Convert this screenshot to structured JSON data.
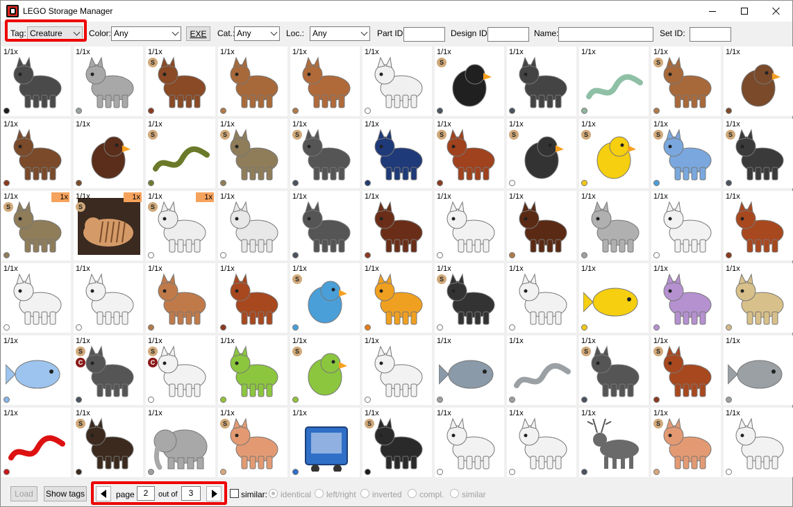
{
  "window": {
    "title": "LEGO Storage Manager"
  },
  "toolbar": {
    "tag_label": "Tag:",
    "tag_value": "Creature",
    "color_label": "Color:",
    "color_value": "Any",
    "exe_label": "EXE",
    "cat_label": "Cat.:",
    "cat_value": "Any",
    "loc_label": "Loc.:",
    "loc_value": "Any",
    "partid_label": "Part ID:",
    "partid_value": "",
    "designid_label": "Design ID:",
    "designid_value": "",
    "name_label": "Name:",
    "name_value": "",
    "setid_label": "Set ID:",
    "setid_value": ""
  },
  "bottom": {
    "load_label": "Load",
    "show_tags_label": "Show tags",
    "page_label": "page",
    "page_value": "2",
    "out_of_label": "out of",
    "total_pages": "3",
    "similar_label": "similar:",
    "options": [
      "identical",
      "left/right",
      "inverted",
      "compl.",
      "similar"
    ]
  },
  "colors": {
    "highlight": "#ee0000",
    "swatches": {
      "black": "#1b1b1b",
      "dkgray": "#4b5260",
      "ltgray": "#9ba0a3",
      "white": "#ffffff",
      "brown": "#7a4a2a",
      "redbrown": "#8a3a1f",
      "mdnougat": "#b07a4a",
      "tan": "#d2b98a",
      "dktan": "#8f7d5a",
      "sandgreen": "#8fb59c",
      "olive": "#707a30",
      "dkblue": "#233a6e",
      "blue": "#2f6fc7",
      "azure": "#4a9fd8",
      "ltblue": "#87b6e8",
      "yellow": "#f3c716",
      "orange": "#e57d1a",
      "lime": "#95c13a",
      "red": "#c81818",
      "lavender": "#b591d0",
      "nougat": "#d9a77a",
      "ltnougat": "#f0c8a0",
      "dkbrown": "#3b2a1d",
      "coral": "#e36a5a"
    }
  },
  "grid": {
    "rows": [
      [
        {
          "count": "1/1x",
          "s": false,
          "c": false,
          "qty": "",
          "icon": "horse-icon",
          "dot": "black",
          "body": "#4a4a4a"
        },
        {
          "count": "1/1x",
          "s": false,
          "c": false,
          "qty": "",
          "icon": "cat-icon",
          "dot": "ltgray",
          "body": "#a8a8a8"
        },
        {
          "count": "1/1x",
          "s": true,
          "c": false,
          "qty": "",
          "icon": "dog-icon",
          "dot": "redbrown",
          "body": "#8a4a25"
        },
        {
          "count": "1/1x",
          "s": false,
          "c": false,
          "qty": "",
          "icon": "rabbit-icon",
          "dot": "mdnougat",
          "body": "#a8693a"
        },
        {
          "count": "1/1x",
          "s": false,
          "c": false,
          "qty": "",
          "icon": "bear-cub-icon",
          "dot": "mdnougat",
          "body": "#b06a3a"
        },
        {
          "count": "1/1x",
          "s": false,
          "c": false,
          "qty": "",
          "icon": "wolf-icon",
          "dot": "white",
          "body": "#f0f0f0"
        },
        {
          "count": "1/1x",
          "s": true,
          "c": false,
          "qty": "",
          "icon": "penguin-icon",
          "dot": "dkgray",
          "body": "#202020"
        },
        {
          "count": "1/1x",
          "s": false,
          "c": false,
          "qty": "",
          "icon": "horse-icon",
          "dot": "dkgray",
          "body": "#444444"
        },
        {
          "count": "1/1x",
          "s": false,
          "c": false,
          "qty": "",
          "icon": "snake-icon",
          "dot": "sandgreen",
          "body": "#8fc0a6"
        },
        {
          "count": "1/1x",
          "s": true,
          "c": false,
          "qty": "",
          "icon": "cat-icon",
          "dot": "mdnougat",
          "body": "#a8693a"
        },
        {
          "count": "1/1x",
          "s": false,
          "c": false,
          "qty": "",
          "icon": "owl-icon",
          "dot": "brown",
          "body": "#7a4a2a"
        }
      ],
      [
        {
          "count": "1/1x",
          "s": false,
          "c": false,
          "qty": "",
          "icon": "rat-icon",
          "dot": "redbrown",
          "body": "#7a4a2a"
        },
        {
          "count": "1/1x",
          "s": false,
          "c": false,
          "qty": "",
          "icon": "eagle-icon",
          "dot": "brown",
          "body": "#5a2e1a"
        },
        {
          "count": "1/1x",
          "s": true,
          "c": false,
          "qty": "",
          "icon": "snake-icon",
          "dot": "olive",
          "body": "#6a7a2a"
        },
        {
          "count": "1/1x",
          "s": true,
          "c": false,
          "qty": "",
          "icon": "rat-icon",
          "dot": "dktan",
          "body": "#8f7d5a"
        },
        {
          "count": "1/1x",
          "s": true,
          "c": false,
          "qty": "",
          "icon": "wolf-icon",
          "dot": "dkgray",
          "body": "#555555"
        },
        {
          "count": "1/1x",
          "s": false,
          "c": false,
          "qty": "",
          "icon": "dinosaur-icon",
          "dot": "dkblue",
          "body": "#1f3a78"
        },
        {
          "count": "1/1x",
          "s": true,
          "c": false,
          "qty": "",
          "icon": "cat-icon",
          "dot": "redbrown",
          "body": "#a0421d"
        },
        {
          "count": "1/1x",
          "s": true,
          "c": false,
          "qty": "",
          "icon": "bird-icon",
          "dot": "white",
          "body": "#333333"
        },
        {
          "count": "1/1x",
          "s": true,
          "c": false,
          "qty": "",
          "icon": "bird-icon",
          "dot": "yellow",
          "body": "#f5cf10"
        },
        {
          "count": "1/1x",
          "s": true,
          "c": false,
          "qty": "",
          "icon": "wolf-icon",
          "dot": "azure",
          "body": "#7aa8de"
        },
        {
          "count": "1/1x",
          "s": true,
          "c": false,
          "qty": "",
          "icon": "bear-icon",
          "dot": "dkgray",
          "body": "#3a3a3a"
        }
      ],
      [
        {
          "count": "1/1x",
          "s": true,
          "c": false,
          "qty": "1x",
          "icon": "sabre-tooth-icon",
          "dot": "dktan",
          "body": "#8f7d5a"
        },
        {
          "count": "1/1x",
          "s": true,
          "c": false,
          "qty": "1x",
          "icon": "tiger-photo-icon",
          "dot": "",
          "body": "#d49a68"
        },
        {
          "count": "1/1x",
          "s": true,
          "c": false,
          "qty": "1x",
          "icon": "polar-bear-icon",
          "dot": "white",
          "body": "#eeeeee"
        },
        {
          "count": "1/1x",
          "s": false,
          "c": false,
          "qty": "",
          "icon": "armadillo-icon",
          "dot": "white",
          "body": "#e8e8e8"
        },
        {
          "count": "1/1x",
          "s": false,
          "c": false,
          "qty": "",
          "icon": "cat-icon",
          "dot": "dkgray",
          "body": "#555555"
        },
        {
          "count": "1/1x",
          "s": false,
          "c": false,
          "qty": "",
          "icon": "horse-icon",
          "dot": "redbrown",
          "body": "#6a2e18"
        },
        {
          "count": "1/1x",
          "s": false,
          "c": false,
          "qty": "",
          "icon": "horse-icon",
          "dot": "white",
          "body": "#f2f2f2"
        },
        {
          "count": "1/1x",
          "s": false,
          "c": false,
          "qty": "",
          "icon": "hedgehog-icon",
          "dot": "mdnougat",
          "body": "#5a2a14"
        },
        {
          "count": "1/1x",
          "s": false,
          "c": false,
          "qty": "",
          "icon": "rabbit-icon",
          "dot": "ltgray",
          "body": "#b0b0b0"
        },
        {
          "count": "1/1x",
          "s": false,
          "c": false,
          "qty": "",
          "icon": "poodle-icon",
          "dot": "white",
          "body": "#f2f2f2"
        },
        {
          "count": "1/1x",
          "s": false,
          "c": false,
          "qty": "",
          "icon": "squirrel-icon",
          "dot": "redbrown",
          "body": "#a8481f"
        }
      ],
      [
        {
          "count": "1/1x",
          "s": false,
          "c": false,
          "qty": "",
          "icon": "poodle-icon",
          "dot": "white",
          "body": "#f2f2f2"
        },
        {
          "count": "1/1x",
          "s": false,
          "c": false,
          "qty": "",
          "icon": "horse-icon",
          "dot": "white",
          "body": "#f2f2f2"
        },
        {
          "count": "1/1x",
          "s": false,
          "c": false,
          "qty": "",
          "icon": "monkey-icon",
          "dot": "mdnougat",
          "body": "#c07a4a"
        },
        {
          "count": "1/1x",
          "s": false,
          "c": false,
          "qty": "",
          "icon": "monkey-icon",
          "dot": "redbrown",
          "body": "#a8481f"
        },
        {
          "count": "1/1x",
          "s": true,
          "c": false,
          "qty": "",
          "icon": "parrot-icon",
          "dot": "azure",
          "body": "#4a9fd8"
        },
        {
          "count": "1/1x",
          "s": false,
          "c": false,
          "qty": "",
          "icon": "tiger-cub-icon",
          "dot": "orange",
          "body": "#f0a020"
        },
        {
          "count": "1/1x",
          "s": true,
          "c": false,
          "qty": "",
          "icon": "panda-icon",
          "dot": "white",
          "body": "#333333"
        },
        {
          "count": "1/1x",
          "s": false,
          "c": false,
          "qty": "",
          "icon": "horse-icon",
          "dot": "white",
          "body": "#f2f2f2"
        },
        {
          "count": "1/1x",
          "s": false,
          "c": false,
          "qty": "",
          "icon": "fish-icon",
          "dot": "yellow",
          "body": "#f5cf10"
        },
        {
          "count": "1/1x",
          "s": false,
          "c": false,
          "qty": "",
          "icon": "turtle-icon",
          "dot": "lavender",
          "body": "#b591d0"
        },
        {
          "count": "1/1x",
          "s": false,
          "c": false,
          "qty": "",
          "icon": "dog-icon",
          "dot": "tan",
          "body": "#d8c08a"
        }
      ],
      [
        {
          "count": "1/1x",
          "s": false,
          "c": false,
          "qty": "",
          "icon": "dolphin-icon",
          "dot": "ltblue",
          "body": "#9cc4ee"
        },
        {
          "count": "1/1x",
          "s": true,
          "c": true,
          "qty": "",
          "icon": "wolf-icon",
          "dot": "dkgray",
          "body": "#555555"
        },
        {
          "count": "1/1x",
          "s": true,
          "c": true,
          "qty": "",
          "icon": "wolf-icon",
          "dot": "white",
          "body": "#f2f2f2"
        },
        {
          "count": "1/1x",
          "s": false,
          "c": false,
          "qty": "",
          "icon": "turtle-icon",
          "dot": "lime",
          "body": "#8cc63e"
        },
        {
          "count": "1/1x",
          "s": true,
          "c": false,
          "qty": "",
          "icon": "bird-icon",
          "dot": "lime",
          "body": "#8cc63e"
        },
        {
          "count": "1/1x",
          "s": false,
          "c": false,
          "qty": "",
          "icon": "polar-bear-icon",
          "dot": "white",
          "body": "#f2f2f2"
        },
        {
          "count": "1/1x",
          "s": false,
          "c": false,
          "qty": "",
          "icon": "shark-head-icon",
          "dot": "ltgray",
          "body": "#8a9aa8"
        },
        {
          "count": "1/1x",
          "s": false,
          "c": false,
          "qty": "",
          "icon": "snake-icon",
          "dot": "ltgray",
          "body": "#9aa0a4"
        },
        {
          "count": "1/1x",
          "s": true,
          "c": false,
          "qty": "",
          "icon": "wolf-icon",
          "dot": "dkgray",
          "body": "#555555"
        },
        {
          "count": "1/1x",
          "s": true,
          "c": false,
          "qty": "",
          "icon": "dog-icon",
          "dot": "redbrown",
          "body": "#a8481f"
        },
        {
          "count": "1/1x",
          "s": false,
          "c": false,
          "qty": "",
          "icon": "fish-icon",
          "dot": "ltgray",
          "body": "#9aa0a4"
        }
      ],
      [
        {
          "count": "1/1x",
          "s": false,
          "c": false,
          "qty": "",
          "icon": "snake-icon",
          "dot": "red",
          "body": "#dd1111"
        },
        {
          "count": "1/1x",
          "s": true,
          "c": false,
          "qty": "",
          "icon": "bear-icon",
          "dot": "dkbrown",
          "body": "#3b2a1d"
        },
        {
          "count": "1/1x",
          "s": false,
          "c": false,
          "qty": "",
          "icon": "elephant-icon",
          "dot": "ltgray",
          "body": "#a8a8a8"
        },
        {
          "count": "1/1x",
          "s": true,
          "c": false,
          "qty": "",
          "icon": "pig-icon",
          "dot": "nougat",
          "body": "#e39a72"
        },
        {
          "count": "1/1x",
          "s": false,
          "c": false,
          "qty": "",
          "icon": "trailer-icon",
          "dot": "blue",
          "body": "#2f6fc7"
        },
        {
          "count": "1/1x",
          "s": true,
          "c": false,
          "qty": "",
          "icon": "cat-icon",
          "dot": "black",
          "body": "#2a2a2a"
        },
        {
          "count": "1/1x",
          "s": false,
          "c": false,
          "qty": "",
          "icon": "cat-icon",
          "dot": "white",
          "body": "#f2f2f2"
        },
        {
          "count": "1/1x",
          "s": false,
          "c": false,
          "qty": "",
          "icon": "cat-icon",
          "dot": "white",
          "body": "#f2f2f2"
        },
        {
          "count": "1/1x",
          "s": false,
          "c": false,
          "qty": "",
          "icon": "reindeer-icon",
          "dot": "dkgray",
          "body": "#6a6a6a"
        },
        {
          "count": "1/1x",
          "s": true,
          "c": false,
          "qty": "",
          "icon": "pig-icon",
          "dot": "nougat",
          "body": "#e39a72"
        },
        {
          "count": "1/1x",
          "s": false,
          "c": false,
          "qty": "",
          "icon": "polar-bear-icon",
          "dot": "white",
          "body": "#f2f2f2"
        }
      ]
    ]
  }
}
